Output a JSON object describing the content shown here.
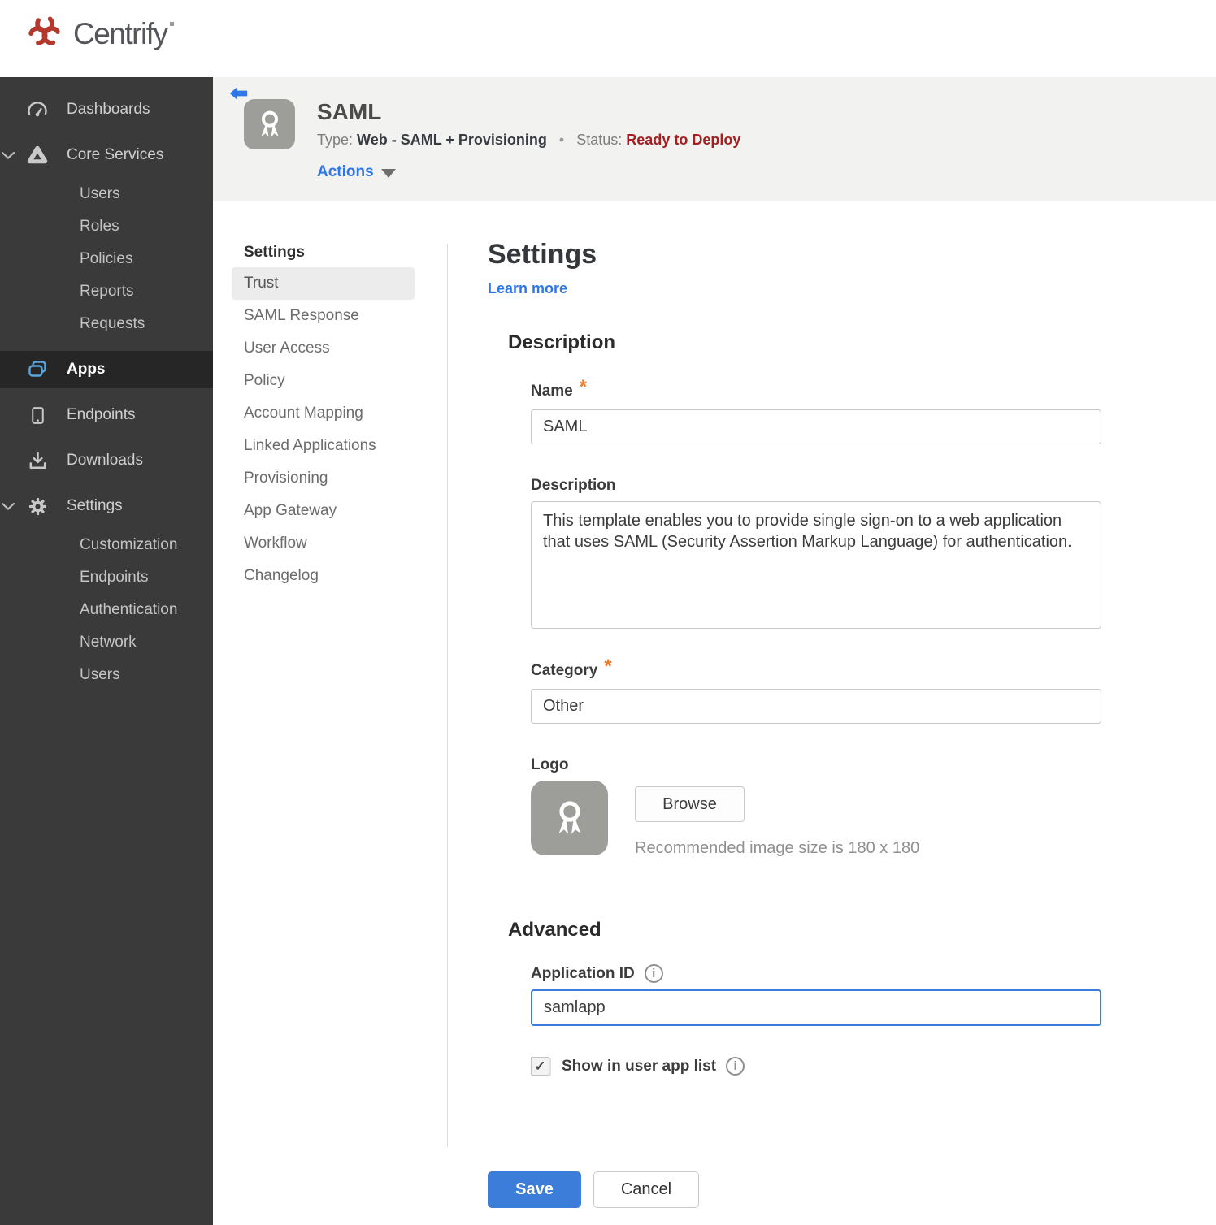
{
  "brand": {
    "name": "Centrify"
  },
  "colors": {
    "logo_red": "#b5382e",
    "sidebar_bg": "#3a3a3a",
    "sidebar_active_bg": "#262626",
    "apps_icon_blue": "#58a6dd",
    "header_bg": "#f2f2f0",
    "link_blue": "#2e77e8",
    "status_red": "#a51f1f",
    "asterisk_orange": "#ee7623",
    "save_blue": "#3b7dd8",
    "selected_subnav_bg": "#ececec"
  },
  "sidebar": {
    "items": [
      {
        "label": "Dashboards"
      },
      {
        "label": "Core Services"
      },
      {
        "label": "Users"
      },
      {
        "label": "Roles"
      },
      {
        "label": "Policies"
      },
      {
        "label": "Reports"
      },
      {
        "label": "Requests"
      },
      {
        "label": "Apps"
      },
      {
        "label": "Endpoints"
      },
      {
        "label": "Downloads"
      },
      {
        "label": "Settings"
      },
      {
        "label": "Customization"
      },
      {
        "label": "Endpoints"
      },
      {
        "label": "Authentication"
      },
      {
        "label": "Network"
      },
      {
        "label": "Users"
      }
    ]
  },
  "header": {
    "title": "SAML",
    "type_label": "Type:",
    "type_value": "Web - SAML + Provisioning",
    "separator": "•",
    "status_label": "Status:",
    "status_value": "Ready to Deploy",
    "actions_label": "Actions"
  },
  "subnav": {
    "heading": "Settings",
    "items": [
      {
        "label": "Trust",
        "active": true
      },
      {
        "label": "SAML Response"
      },
      {
        "label": "User Access"
      },
      {
        "label": "Policy"
      },
      {
        "label": "Account Mapping"
      },
      {
        "label": "Linked Applications"
      },
      {
        "label": "Provisioning"
      },
      {
        "label": "App Gateway"
      },
      {
        "label": "Workflow"
      },
      {
        "label": "Changelog"
      }
    ]
  },
  "main": {
    "title": "Settings",
    "learn_more": "Learn more",
    "required_marker": "*",
    "description_section": {
      "title": "Description",
      "name_label": "Name",
      "name_value": "SAML",
      "description_label": "Description",
      "description_value": "This template enables you to provide single sign-on to a web application that uses SAML (Security Assertion Markup Language) for authentication.",
      "category_label": "Category",
      "category_value": "Other",
      "logo_label": "Logo",
      "browse_label": "Browse",
      "recommended_text": "Recommended image size is 180 x 180"
    },
    "advanced_section": {
      "title": "Advanced",
      "app_id_label": "Application ID",
      "app_id_value": "samlapp",
      "show_in_user_app_list_label": "Show in user app list",
      "show_in_user_app_list_checked": true
    },
    "buttons": {
      "save": "Save",
      "cancel": "Cancel"
    }
  }
}
